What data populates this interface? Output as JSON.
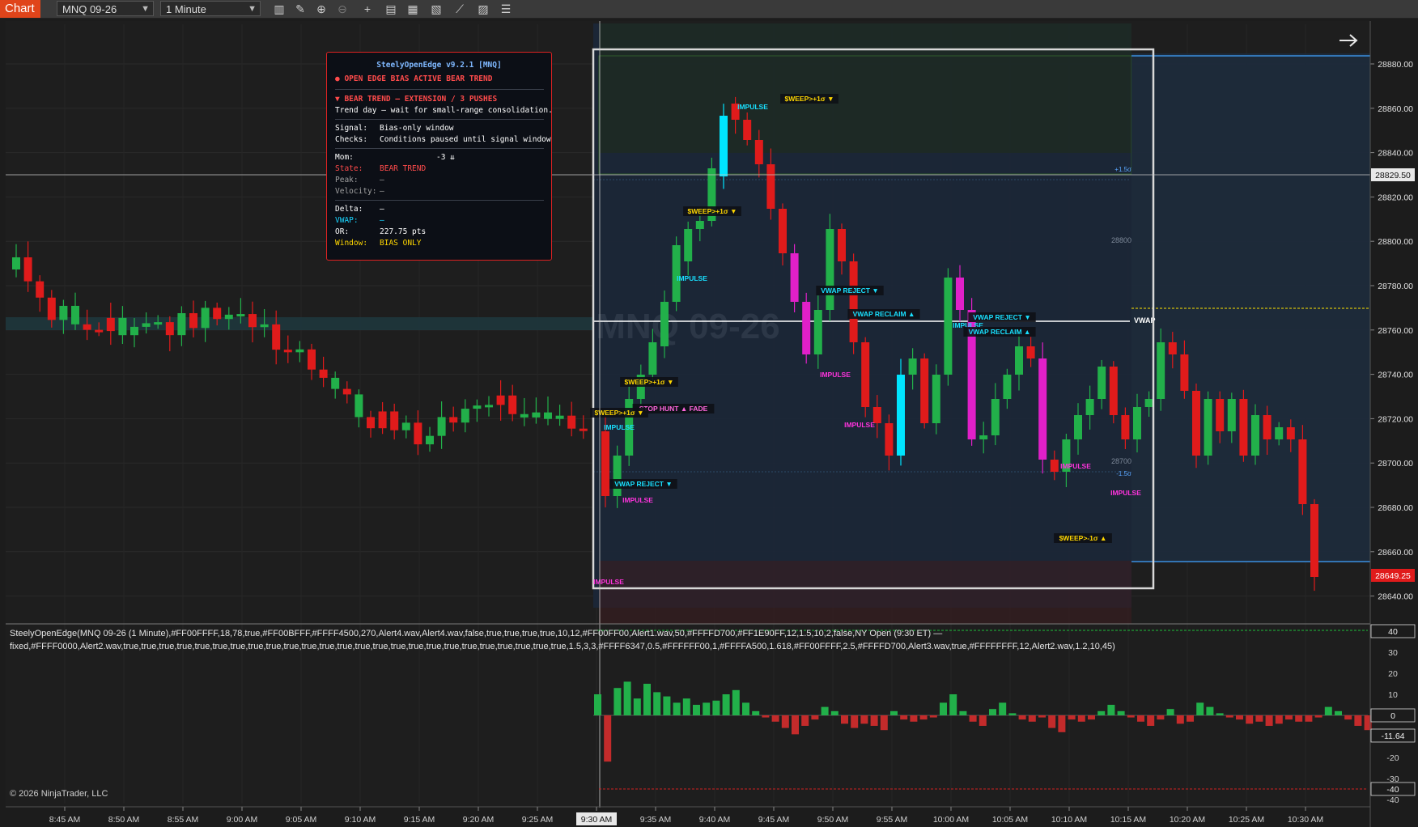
{
  "toolbar": {
    "chart_tab": "Chart",
    "instrument": "MNQ 09-26",
    "interval": "1 Minute",
    "icons": [
      "bar-type-icon",
      "draw-tool-icon",
      "zoom-in-icon",
      "zoom-out-icon",
      "crosshair-icon",
      "properties-icon",
      "data-box-icon",
      "indicators-icon",
      "strategies-icon",
      "templates-icon",
      "list-icon"
    ]
  },
  "chart": {
    "watermark": "MNQ 09-26",
    "crosshair_price": "28829.50",
    "last_price": "28649.25",
    "price_ticks": [
      "28880.00",
      "28860.00",
      "28840.00",
      "28820.00",
      "28800.00",
      "28780.00",
      "28760.00",
      "28740.00",
      "28720.00",
      "28700.00",
      "28680.00",
      "28660.00",
      "28640.00"
    ],
    "time_ticks": [
      "8:45 AM",
      "8:50 AM",
      "8:55 AM",
      "9:00 AM",
      "9:05 AM",
      "9:10 AM",
      "9:15 AM",
      "9:20 AM",
      "9:25 AM",
      "9:30 AM",
      "9:35 AM",
      "9:40 AM",
      "9:45 AM",
      "9:50 AM",
      "9:55 AM",
      "10:00 AM",
      "10:05 AM",
      "10:10 AM",
      "10:15 AM",
      "10:20 AM",
      "10:25 AM",
      "10:30 AM"
    ],
    "selected_time": "9:30 AM",
    "level_labels": {
      "vwap": "VWAP",
      "plus_sigma": "+1.5σ",
      "minus_sigma": "-1.5σ",
      "l28800": "28800",
      "l28700": "28700"
    },
    "colors": {
      "up": "#22b04a",
      "down": "#e01b1b",
      "impulse_up": "#00e5ff",
      "impulse_down": "#e020c8",
      "sweep": "#ffd700",
      "range_box": "#cfcfcf"
    }
  },
  "tags": [
    {
      "text": "IMPULSE",
      "color": "#19e0ff"
    },
    {
      "text": "$WEEP>+1σ ▼",
      "color": "#ffd700"
    },
    {
      "text": "$WEEP>+1σ ▼",
      "color": "#ffd700"
    },
    {
      "text": "IMPULSE",
      "color": "#19e0ff"
    },
    {
      "text": "$WEEP>+1σ ▼",
      "color": "#ffd700"
    },
    {
      "text": "STOP HUNT ▲ FADE",
      "color": "#ff66dd"
    },
    {
      "text": "$WEEP>+1σ ▼",
      "color": "#ffd700"
    },
    {
      "text": "IMPULSE",
      "color": "#19e0ff"
    },
    {
      "text": "VWAP REJECT ▼",
      "color": "#19e0ff"
    },
    {
      "text": "IMPULSE",
      "color": "#ff33dd"
    },
    {
      "text": "IMPULSE",
      "color": "#ff33dd"
    },
    {
      "text": "VWAP REJECT ▼",
      "color": "#19e0ff"
    },
    {
      "text": "VWAP RECLAIM ▲",
      "color": "#19e0ff"
    },
    {
      "text": "IMPULSE",
      "color": "#ff33dd"
    },
    {
      "text": "IMPULSE",
      "color": "#ff33dd"
    },
    {
      "text": "IMPULSE",
      "color": "#19e0ff"
    },
    {
      "text": "VWAP RECLAIM ▲",
      "color": "#19e0ff"
    },
    {
      "text": "VWAP REJECT ▼",
      "color": "#19e0ff"
    },
    {
      "text": "IMPULSE",
      "color": "#ff33dd"
    },
    {
      "text": "$WEEP>-1σ ▲",
      "color": "#ffd700"
    },
    {
      "text": "IMPULSE",
      "color": "#ff33dd"
    }
  ],
  "hud": {
    "title": "SteelyOpenEdge v9.2.1  [MNQ]",
    "status": "● OPEN EDGE BIAS ACTIVE  BEAR TREND",
    "trend": "▼ BEAR TREND — EXTENSION / 3 PUSHES",
    "trend_note": "Trend day — wait for small-range consolidation.",
    "signal_label": "Signal:",
    "signal_value": "Bias-only window",
    "checks_label": "Checks:",
    "checks_value": "Conditions paused until signal window",
    "mom_label": "Mom:",
    "mom_value": "-3 ⇊",
    "state_label": "State:",
    "state_value": "BEAR TREND",
    "peak_label": "Peak:",
    "peak_value": "—",
    "velocity_label": "Velocity:",
    "velocity_value": "—",
    "delta_label": "Delta:",
    "delta_value": "—",
    "vwap_label": "VWAP:",
    "vwap_value": "—",
    "or_label": "OR:",
    "or_value": "227.75 pts",
    "window_label": "Window:",
    "window_value": "BIAS ONLY"
  },
  "indicator": {
    "params_line1": "SteelyOpenEdge(MNQ 09-26 (1 Minute),#FF00FFFF,18,78,true,#FF00BFFF,#FFFF4500,270,Alert4.wav,Alert4.wav,false,true,true,true,true,10,12,#FF00FF00,Alert1.wav,50,#FFFFD700,#FF1E90FF,12,1.5,10,2,false,NY Open (9:30 ET) —",
    "params_line2": "fixed,#FFFF0000,Alert2.wav,true,true,true,true,true,true,true,true,true,true,true,true,true,true,true,true,true,true,true,true,true,true,true,true,true,1.5,3,3,#FFFF6347,0.5,#FFFFFF00,1,#FFFFA500,1.618,#FF00FFFF,2.5,#FFFFD700,Alert3.wav,true,#FFFFFFFF,12,Alert2.wav,1.2,10,45)",
    "axis_ticks": [
      "40",
      "30",
      "20",
      "10",
      "0",
      "-10",
      "-20",
      "-30",
      "-40"
    ],
    "current_value": "-11.64",
    "flagged_high": "40",
    "flagged_zero": "0",
    "flagged_low": "-40"
  },
  "footer": {
    "copyright": "© 2026 NinjaTrader, LLC"
  }
}
